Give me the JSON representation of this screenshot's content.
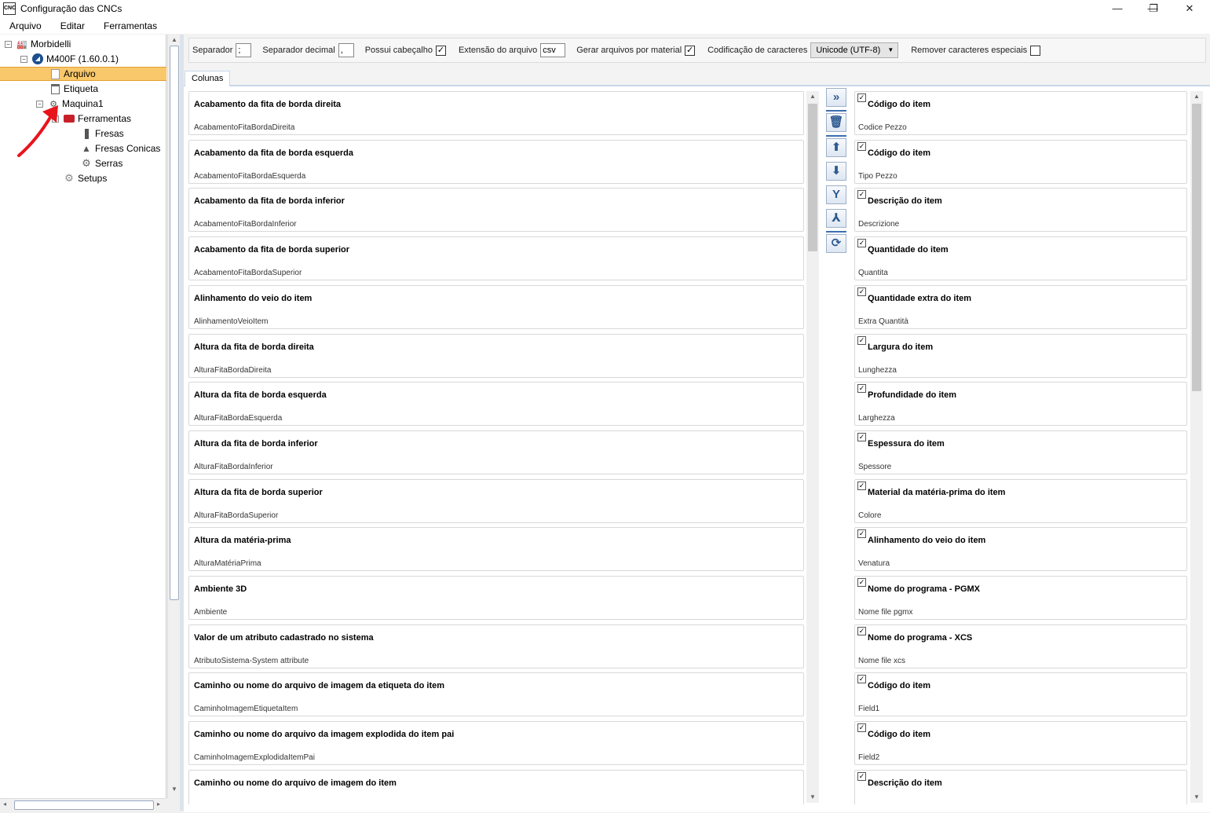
{
  "window": {
    "app_icon_text": "CNC",
    "title": "Configuração das CNCs",
    "minimize_glyph": "—",
    "restore_glyph": "❐",
    "close_glyph": "✕"
  },
  "menu": [
    "Arquivo",
    "Editar",
    "Ferramentas"
  ],
  "tree": {
    "expand_glyph": "−",
    "items": [
      {
        "label": "Morbidelli",
        "icon": "factory-icon",
        "glyph": "🏭"
      },
      {
        "label": "M400F (1.60.0.1)",
        "icon": "machine-logo-icon",
        "glyph": "◢"
      },
      {
        "label": "Arquivo",
        "icon": "file-icon",
        "glyph": "📄"
      },
      {
        "label": "Etiqueta",
        "icon": "label-icon",
        "glyph": "📃"
      },
      {
        "label": "Maquina1",
        "icon": "machine-icon",
        "glyph": "⚙"
      },
      {
        "label": "Ferramentas",
        "icon": "toolbox-icon",
        "glyph": "🧰"
      },
      {
        "label": "Fresas",
        "icon": "mill-bit-icon",
        "glyph": "▮"
      },
      {
        "label": "Fresas Conicas",
        "icon": "conical-mill-icon",
        "glyph": "▲"
      },
      {
        "label": "Serras",
        "icon": "saw-icon",
        "glyph": "⚙"
      },
      {
        "label": "Setups",
        "icon": "setup-gear-icon",
        "glyph": "⚙"
      }
    ]
  },
  "options": {
    "separator_label": "Separador",
    "separator_value": ";",
    "decimal_label": "Separador decimal",
    "decimal_value": ",",
    "header_label": "Possui cabeçalho",
    "extension_label": "Extensão do arquivo",
    "extension_value": "csv",
    "per_material_label": "Gerar arquivos por material",
    "encoding_label": "Codificação de caracteres",
    "encoding_value": "Unicode (UTF-8)",
    "remove_special_label": "Remover caracteres especiais",
    "check_glyph": "✓",
    "dropdown_glyph": "▼"
  },
  "tab": {
    "label": "Colunas"
  },
  "available_columns": [
    {
      "title": "Acabamento da fita de borda direita",
      "field": "AcabamentoFitaBordaDireita"
    },
    {
      "title": "Acabamento da fita de borda esquerda",
      "field": "AcabamentoFitaBordaEsquerda"
    },
    {
      "title": "Acabamento da fita de borda inferior",
      "field": "AcabamentoFitaBordaInferior"
    },
    {
      "title": "Acabamento da fita de borda superior",
      "field": "AcabamentoFitaBordaSuperior"
    },
    {
      "title": "Alinhamento do veio do item",
      "field": "AlinhamentoVeioItem"
    },
    {
      "title": "Altura da fita de borda direita",
      "field": "AlturaFitaBordaDireita"
    },
    {
      "title": "Altura da fita de borda esquerda",
      "field": "AlturaFitaBordaEsquerda"
    },
    {
      "title": "Altura da fita de borda inferior",
      "field": "AlturaFitaBordaInferior"
    },
    {
      "title": "Altura da fita de borda superior",
      "field": "AlturaFitaBordaSuperior"
    },
    {
      "title": "Altura da matéria-prima",
      "field": "AlturaMatériaPrima"
    },
    {
      "title": "Ambiente 3D",
      "field": "Ambiente"
    },
    {
      "title": "Valor de um atributo cadastrado no sistema",
      "field": "AtributoSistema-System attribute"
    },
    {
      "title": "Caminho ou nome do arquivo de imagem da etiqueta do item",
      "field": "CaminhoImagemEtiquetaItem"
    },
    {
      "title": "Caminho ou nome do arquivo da imagem explodida do item pai",
      "field": "CaminhoImagemExplodidaItemPai"
    },
    {
      "title": "Caminho ou nome do arquivo de imagem do item",
      "field": ""
    }
  ],
  "selected_columns": [
    {
      "title": "Código do item",
      "field": "Codice Pezzo"
    },
    {
      "title": "Código do item",
      "field": "Tipo Pezzo"
    },
    {
      "title": "Descrição do item",
      "field": "Descrizione"
    },
    {
      "title": "Quantidade do item",
      "field": "Quantita"
    },
    {
      "title": "Quantidade extra do item",
      "field": "Extra Quantità"
    },
    {
      "title": "Largura do item",
      "field": "Lunghezza"
    },
    {
      "title": "Profundidade do item",
      "field": "Larghezza"
    },
    {
      "title": "Espessura do item",
      "field": "Spessore"
    },
    {
      "title": "Material da matéria-prima do item",
      "field": "Colore"
    },
    {
      "title": "Alinhamento do veio do item",
      "field": "Venatura"
    },
    {
      "title": "Nome do programa - PGMX",
      "field": "Nome file pgmx"
    },
    {
      "title": "Nome do programa - XCS",
      "field": "Nome file xcs"
    },
    {
      "title": "Código do item",
      "field": "Field1"
    },
    {
      "title": "Código do item",
      "field": "Field2"
    },
    {
      "title": "Descrição do item",
      "field": ""
    }
  ],
  "toolbar": {
    "add_glyph": "»",
    "delete_glyph": "🗑",
    "up_glyph": "⬆",
    "down_glyph": "⬇",
    "merge_glyph": "Y",
    "split_glyph": "⅄",
    "refresh_glyph": "⟳"
  },
  "accent_color": "#3c6fb0",
  "selection_color": "#f9c86b",
  "annotation_color": "#e8141c"
}
